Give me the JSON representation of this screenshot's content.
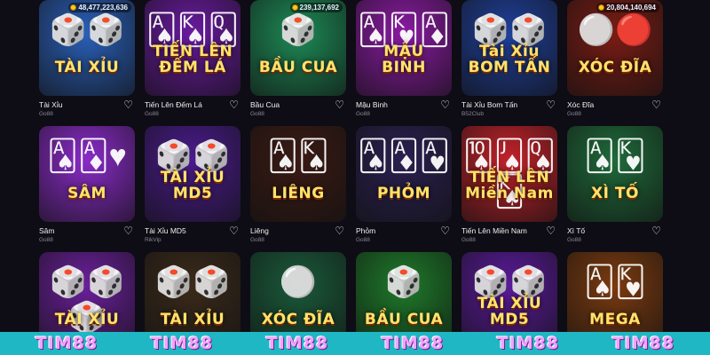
{
  "games": [
    {
      "title": "Tài Xỉu",
      "provider": "Go88",
      "logo": "TÀI XỈU",
      "deco": "🎲🎲",
      "jackpot": "48,477,223,636",
      "bg": "#2a5fb8"
    },
    {
      "title": "Tiến Lên Đếm Lá",
      "provider": "Go88",
      "logo": "TIẾN LÊN ĐẾM LÁ",
      "deco": "🂡🂮🂭",
      "jackpot": "",
      "bg": "#6a1aa0"
    },
    {
      "title": "Bầu Cua",
      "provider": "Go88",
      "logo": "BẦU CUA",
      "deco": "🎲",
      "jackpot": "239,137,692",
      "bg": "#1d8a56"
    },
    {
      "title": "Mậu Binh",
      "provider": "Go88",
      "logo": "MẬU BINH",
      "deco": "🂡🂾🃁",
      "jackpot": "",
      "bg": "#8b1aa3"
    },
    {
      "title": "Tài Xỉu Bom Tấn",
      "provider": "B52Club",
      "logo": "Tài Xỉu BOM TẤN",
      "deco": "🎲🎲",
      "jackpot": "",
      "bg": "#1f3f9a"
    },
    {
      "title": "Xóc Đĩa",
      "provider": "Go88",
      "logo": "XÓC ĐĨA",
      "deco": "⚪🔴",
      "jackpot": "20,804,140,694",
      "bg": "#7a1c14"
    },
    {
      "title": "Sâm",
      "provider": "Go88",
      "logo": "SÂM",
      "deco": "🂡🃁♥",
      "jackpot": "",
      "bg": "#8a2bc9"
    },
    {
      "title": "Tài Xỉu MD5",
      "provider": "RikVip",
      "logo": "TÀI XỈU MD5",
      "deco": "🎲🎲",
      "jackpot": "",
      "bg": "#4a1b8c"
    },
    {
      "title": "Liêng",
      "provider": "Go88",
      "logo": "LIÊNG",
      "deco": "🂡🂮",
      "jackpot": "",
      "bg": "#3a1a14"
    },
    {
      "title": "Phỏm",
      "provider": "Go88",
      "logo": "PHỎM",
      "deco": "🂡🃁🂱",
      "jackpot": "",
      "bg": "#2a2050"
    },
    {
      "title": "Tiến Lên Miền Nam",
      "provider": "Go88",
      "logo": "TIẾN LÊN Miền Nam",
      "deco": "🂪🂫🂭🂮",
      "jackpot": "",
      "bg": "#c2222a"
    },
    {
      "title": "Xì Tố",
      "provider": "Go88",
      "logo": "XÌ TỐ",
      "deco": "🂡🂾",
      "jackpot": "",
      "bg": "#1f6a3a"
    },
    {
      "title": "",
      "provider": "",
      "logo": "TÀI XỈU",
      "deco": "🎲🎲🎲",
      "jackpot": "",
      "bg": "#6a1f9a"
    },
    {
      "title": "",
      "provider": "",
      "logo": "TÀI XỈU",
      "deco": "🎲🎲",
      "jackpot": "",
      "bg": "#3a2a1a"
    },
    {
      "title": "",
      "provider": "",
      "logo": "XÓC ĐĨA",
      "deco": "⚪",
      "jackpot": "",
      "bg": "#1a5a3a"
    },
    {
      "title": "",
      "provider": "",
      "logo": "BẦU CUA",
      "deco": "🎲",
      "jackpot": "",
      "bg": "#1e7a2a"
    },
    {
      "title": "",
      "provider": "",
      "logo": "TÀI XỈU MD5",
      "deco": "🎲🎲",
      "jackpot": "",
      "bg": "#5a1a9a"
    },
    {
      "title": "",
      "provider": "",
      "logo": "MEGA",
      "deco": "🂡🂾",
      "jackpot": "",
      "bg": "#7a3a10"
    }
  ],
  "footer": {
    "brand": [
      "TIM88",
      "TIM88",
      "TIM88",
      "TIM88",
      "TIM88",
      "TIM88"
    ]
  },
  "icons": {
    "favorite": "heart-outline-icon",
    "jackpot": "coin-icon"
  },
  "colors": {
    "background": "#0e0c14",
    "footer": "#1fb7c4",
    "brand": "#f0a3ff"
  }
}
